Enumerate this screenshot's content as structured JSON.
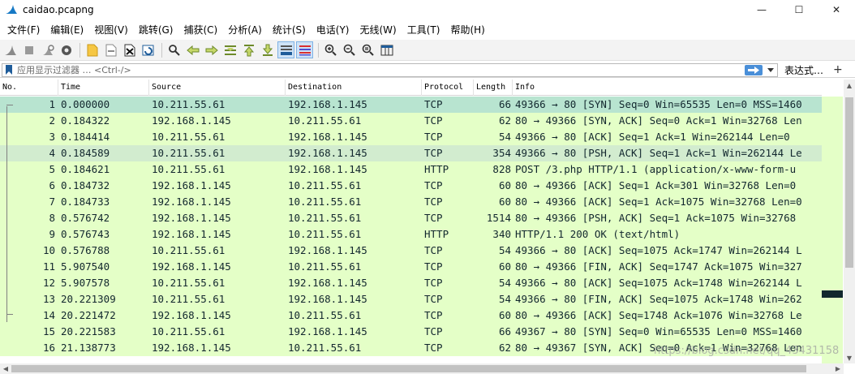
{
  "window": {
    "title": "caidao.pcapng",
    "minimize": "—",
    "maximize": "☐",
    "close": "✕"
  },
  "menu": [
    "文件(F)",
    "编辑(E)",
    "视图(V)",
    "跳转(G)",
    "捕获(C)",
    "分析(A)",
    "统计(S)",
    "电话(Y)",
    "无线(W)",
    "工具(T)",
    "帮助(H)"
  ],
  "toolbar": {
    "icons": [
      "shark-fin-icon",
      "stop-icon",
      "restart-icon",
      "options-icon",
      "open-file-icon",
      "file-set-icon",
      "close-file-icon",
      "reload-icon",
      "find-icon",
      "go-back-icon",
      "go-forward-icon",
      "go-to-packet-icon",
      "first-packet-icon",
      "last-packet-icon",
      "auto-scroll-icon",
      "colorize-icon",
      "zoom-in-icon",
      "zoom-out-icon",
      "normal-size-icon",
      "resize-columns-icon"
    ]
  },
  "filter": {
    "placeholder": "应用显示过滤器 … <Ctrl-/>",
    "expression_label": "表达式…",
    "add_label": "+"
  },
  "columns": [
    "No.",
    "Time",
    "Source",
    "Destination",
    "Protocol",
    "Length",
    "Info"
  ],
  "colors": {
    "tcp_row": "#e4ffc7",
    "tcp_row_alt": "#e7e6ff",
    "selected_row": "#b8e4d0",
    "related_row": "#d2eccf",
    "text": "#12272e"
  },
  "packets": [
    {
      "no": "1",
      "time": "0.000000",
      "src": "10.211.55.61",
      "dst": "192.168.1.145",
      "proto": "TCP",
      "len": "66",
      "info": "49366 → 80 [SYN] Seq=0 Win=65535 Len=0 MSS=1460",
      "state": "selected"
    },
    {
      "no": "2",
      "time": "0.184322",
      "src": "192.168.1.145",
      "dst": "10.211.55.61",
      "proto": "TCP",
      "len": "62",
      "info": "80 → 49366 [SYN, ACK] Seq=0 Ack=1 Win=32768 Len",
      "state": "normal"
    },
    {
      "no": "3",
      "time": "0.184414",
      "src": "10.211.55.61",
      "dst": "192.168.1.145",
      "proto": "TCP",
      "len": "54",
      "info": "49366 → 80 [ACK] Seq=1 Ack=1 Win=262144 Len=0",
      "state": "normal"
    },
    {
      "no": "4",
      "time": "0.184589",
      "src": "10.211.55.61",
      "dst": "192.168.1.145",
      "proto": "TCP",
      "len": "354",
      "info": "49366 → 80 [PSH, ACK] Seq=1 Ack=1 Win=262144 Le",
      "state": "related"
    },
    {
      "no": "5",
      "time": "0.184621",
      "src": "10.211.55.61",
      "dst": "192.168.1.145",
      "proto": "HTTP",
      "len": "828",
      "info": "POST /3.php HTTP/1.1  (application/x-www-form-u",
      "state": "normal"
    },
    {
      "no": "6",
      "time": "0.184732",
      "src": "192.168.1.145",
      "dst": "10.211.55.61",
      "proto": "TCP",
      "len": "60",
      "info": "80 → 49366 [ACK] Seq=1 Ack=301 Win=32768 Len=0",
      "state": "normal"
    },
    {
      "no": "7",
      "time": "0.184733",
      "src": "192.168.1.145",
      "dst": "10.211.55.61",
      "proto": "TCP",
      "len": "60",
      "info": "80 → 49366 [ACK] Seq=1 Ack=1075 Win=32768 Len=0",
      "state": "normal"
    },
    {
      "no": "8",
      "time": "0.576742",
      "src": "192.168.1.145",
      "dst": "10.211.55.61",
      "proto": "TCP",
      "len": "1514",
      "info": "80 → 49366 [PSH, ACK] Seq=1 Ack=1075 Win=32768",
      "state": "normal"
    },
    {
      "no": "9",
      "time": "0.576743",
      "src": "192.168.1.145",
      "dst": "10.211.55.61",
      "proto": "HTTP",
      "len": "340",
      "info": "HTTP/1.1 200 OK  (text/html)",
      "state": "normal"
    },
    {
      "no": "10",
      "time": "0.576788",
      "src": "10.211.55.61",
      "dst": "192.168.1.145",
      "proto": "TCP",
      "len": "54",
      "info": "49366 → 80 [ACK] Seq=1075 Ack=1747 Win=262144 L",
      "state": "normal"
    },
    {
      "no": "11",
      "time": "5.907540",
      "src": "192.168.1.145",
      "dst": "10.211.55.61",
      "proto": "TCP",
      "len": "60",
      "info": "80 → 49366 [FIN, ACK] Seq=1747 Ack=1075 Win=327",
      "state": "normal"
    },
    {
      "no": "12",
      "time": "5.907578",
      "src": "10.211.55.61",
      "dst": "192.168.1.145",
      "proto": "TCP",
      "len": "54",
      "info": "49366 → 80 [ACK] Seq=1075 Ack=1748 Win=262144 L",
      "state": "normal"
    },
    {
      "no": "13",
      "time": "20.221309",
      "src": "10.211.55.61",
      "dst": "192.168.1.145",
      "proto": "TCP",
      "len": "54",
      "info": "49366 → 80 [FIN, ACK] Seq=1075 Ack=1748 Win=262",
      "state": "normal"
    },
    {
      "no": "14",
      "time": "20.221472",
      "src": "192.168.1.145",
      "dst": "10.211.55.61",
      "proto": "TCP",
      "len": "60",
      "info": "80 → 49366 [ACK] Seq=1748 Ack=1076 Win=32768 Le",
      "state": "normal"
    },
    {
      "no": "15",
      "time": "20.221583",
      "src": "10.211.55.61",
      "dst": "192.168.1.145",
      "proto": "TCP",
      "len": "66",
      "info": "49367 → 80 [SYN] Seq=0 Win=65535 Len=0 MSS=1460",
      "state": "normal"
    },
    {
      "no": "16",
      "time": "21.138773",
      "src": "192.168.1.145",
      "dst": "10.211.55.61",
      "proto": "TCP",
      "len": "62",
      "info": "80 → 49367 [SYN, ACK] Seq=0 Ack=1 Win=32768 Len",
      "state": "normal"
    }
  ],
  "watermark": "https://blog.csdn.net/qq_43431158"
}
